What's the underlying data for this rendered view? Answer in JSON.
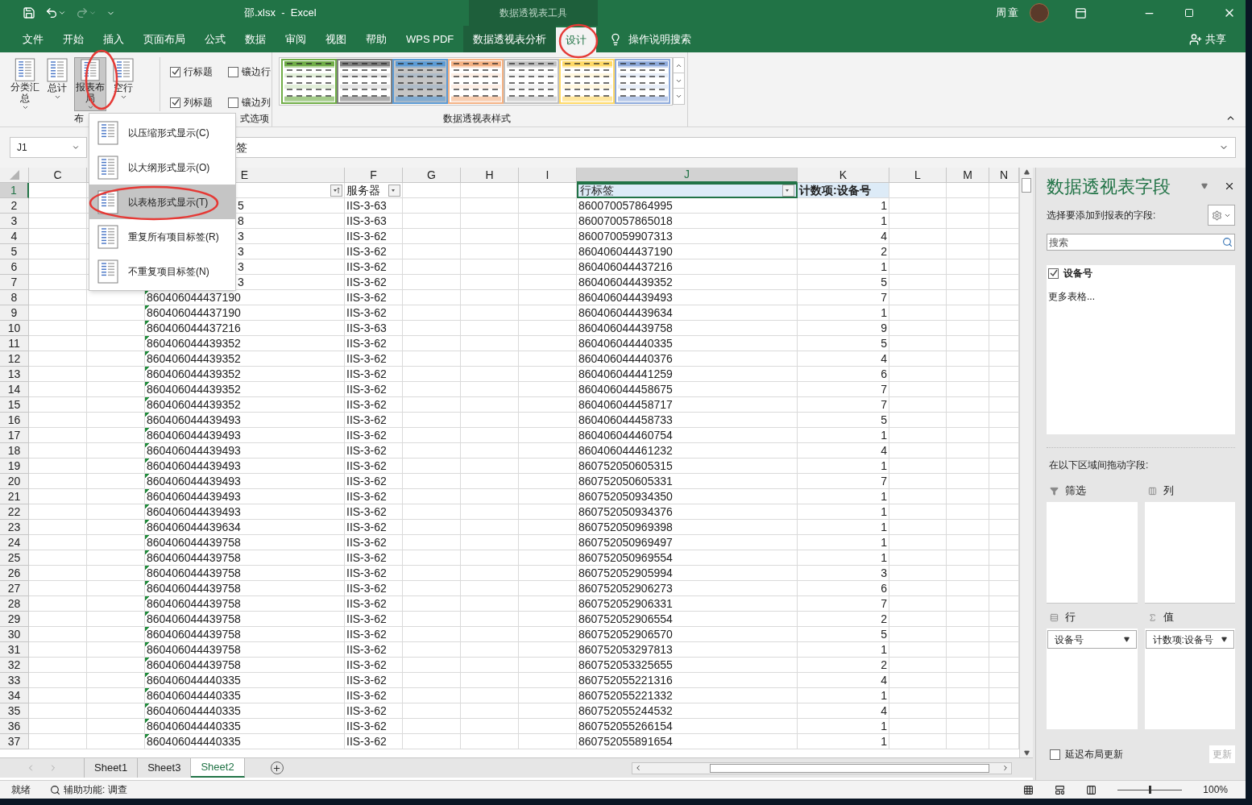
{
  "title_bar": {
    "title": "邵.xlsx  -  Excel",
    "context_label": "数据透视表工具",
    "user": "周童"
  },
  "ribbon_tabs": [
    {
      "label": "文件",
      "selected": false,
      "contextual": false
    },
    {
      "label": "开始",
      "selected": false,
      "contextual": false
    },
    {
      "label": "插入",
      "selected": false,
      "contextual": false
    },
    {
      "label": "页面布局",
      "selected": false,
      "contextual": false
    },
    {
      "label": "公式",
      "selected": false,
      "contextual": false
    },
    {
      "label": "数据",
      "selected": false,
      "contextual": false
    },
    {
      "label": "审阅",
      "selected": false,
      "contextual": false
    },
    {
      "label": "视图",
      "selected": false,
      "contextual": false
    },
    {
      "label": "帮助",
      "selected": false,
      "contextual": false
    },
    {
      "label": "WPS PDF",
      "selected": false,
      "contextual": false
    },
    {
      "label": "数据透视表分析",
      "selected": false,
      "contextual": true
    },
    {
      "label": "设计",
      "selected": true,
      "contextual": true
    }
  ],
  "tell_me": "操作说明搜索",
  "share": "共享",
  "ribbon": {
    "layout_group": {
      "label": "布",
      "buttons": [
        {
          "label": "分类汇总",
          "pressed": false
        },
        {
          "label": "总计",
          "pressed": false
        },
        {
          "label": "报表布局",
          "pressed": true
        },
        {
          "label": "空行",
          "pressed": false
        }
      ]
    },
    "options_group": {
      "label": "式选项",
      "options": [
        {
          "label": "行标题",
          "checked": true
        },
        {
          "label": "镶边行",
          "checked": false
        },
        {
          "label": "列标题",
          "checked": true
        },
        {
          "label": "镶边列",
          "checked": false
        }
      ]
    },
    "styles_group": {
      "label": "数据透视表样式",
      "styles": [
        {
          "color": "#70ad47",
          "selected": false
        },
        {
          "color": "#7f7f7f",
          "selected": false
        },
        {
          "color": "#5b9bd5",
          "selected": true
        },
        {
          "color": "#f4b183",
          "selected": false
        },
        {
          "color": "#bfbfbf",
          "selected": false
        },
        {
          "color": "#ffd966",
          "selected": false
        },
        {
          "color": "#8eaadb",
          "selected": false
        }
      ]
    }
  },
  "report_layout_menu": [
    {
      "label": "以压缩形式显示(C)",
      "selected": false
    },
    {
      "label": "以大纲形式显示(O)",
      "selected": false
    },
    {
      "label": "以表格形式显示(T)",
      "selected": true
    },
    {
      "label": "重复所有项目标签(R)",
      "selected": false
    },
    {
      "label": "不重复项目标签(N)",
      "selected": false
    }
  ],
  "formula_bar": {
    "name_box": "J1",
    "content": "签"
  },
  "columns": [
    {
      "letter": "C",
      "selected": false
    },
    {
      "letter": "E",
      "selected": false
    },
    {
      "letter": "F",
      "selected": false
    },
    {
      "letter": "G",
      "selected": false
    },
    {
      "letter": "H",
      "selected": false
    },
    {
      "letter": "I",
      "selected": false
    },
    {
      "letter": "J",
      "selected": true
    },
    {
      "letter": "K",
      "selected": false
    },
    {
      "letter": "L",
      "selected": false
    },
    {
      "letter": "M",
      "selected": false
    },
    {
      "letter": "N",
      "selected": false
    }
  ],
  "header_row": {
    "number": "1",
    "selected": true,
    "f": "服务器",
    "j": "行标签",
    "k": "计数项:设备号"
  },
  "rows": [
    {
      "number": "2",
      "e": "5",
      "e_cut": true,
      "f": "IIS-3-63",
      "j": "860070057864995",
      "k": "1"
    },
    {
      "number": "3",
      "e": "8",
      "e_cut": true,
      "f": "IIS-3-63",
      "j": "860070057865018",
      "k": "1"
    },
    {
      "number": "4",
      "e": "3",
      "e_cut": true,
      "f": "IIS-3-62",
      "j": "860070059907313",
      "k": "4"
    },
    {
      "number": "5",
      "e": "3",
      "e_cut": true,
      "f": "IIS-3-62",
      "j": "860406044437190",
      "k": "2"
    },
    {
      "number": "6",
      "e": "3",
      "e_cut": true,
      "f": "IIS-3-62",
      "j": "860406044437216",
      "k": "1"
    },
    {
      "number": "7",
      "e": "3",
      "e_cut": true,
      "f": "IIS-3-62",
      "j": "860406044439352",
      "k": "5"
    },
    {
      "number": "8",
      "e": "860406044437190",
      "e_cut": false,
      "flag": true,
      "f": "IIS-3-62",
      "j": "860406044439493",
      "k": "7"
    },
    {
      "number": "9",
      "e": "860406044437190",
      "e_cut": false,
      "flag": true,
      "f": "IIS-3-62",
      "j": "860406044439634",
      "k": "1"
    },
    {
      "number": "10",
      "e": "860406044437216",
      "e_cut": false,
      "flag": true,
      "f": "IIS-3-63",
      "j": "860406044439758",
      "k": "9"
    },
    {
      "number": "11",
      "e": "860406044439352",
      "e_cut": false,
      "flag": true,
      "f": "IIS-3-62",
      "j": "860406044440335",
      "k": "5"
    },
    {
      "number": "12",
      "e": "860406044439352",
      "e_cut": false,
      "flag": true,
      "f": "IIS-3-62",
      "j": "860406044440376",
      "k": "4"
    },
    {
      "number": "13",
      "e": "860406044439352",
      "e_cut": false,
      "flag": true,
      "f": "IIS-3-62",
      "j": "860406044441259",
      "k": "6"
    },
    {
      "number": "14",
      "e": "860406044439352",
      "e_cut": false,
      "flag": true,
      "f": "IIS-3-62",
      "j": "860406044458675",
      "k": "7"
    },
    {
      "number": "15",
      "e": "860406044439352",
      "e_cut": false,
      "flag": true,
      "f": "IIS-3-62",
      "j": "860406044458717",
      "k": "7"
    },
    {
      "number": "16",
      "e": "860406044439493",
      "e_cut": false,
      "flag": true,
      "f": "IIS-3-62",
      "j": "860406044458733",
      "k": "5"
    },
    {
      "number": "17",
      "e": "860406044439493",
      "e_cut": false,
      "flag": true,
      "f": "IIS-3-62",
      "j": "860406044460754",
      "k": "1"
    },
    {
      "number": "18",
      "e": "860406044439493",
      "e_cut": false,
      "flag": true,
      "f": "IIS-3-62",
      "j": "860406044461232",
      "k": "4"
    },
    {
      "number": "19",
      "e": "860406044439493",
      "e_cut": false,
      "flag": true,
      "f": "IIS-3-62",
      "j": "860752050605315",
      "k": "1"
    },
    {
      "number": "20",
      "e": "860406044439493",
      "e_cut": false,
      "flag": true,
      "f": "IIS-3-62",
      "j": "860752050605331",
      "k": "7"
    },
    {
      "number": "21",
      "e": "860406044439493",
      "e_cut": false,
      "flag": true,
      "f": "IIS-3-62",
      "j": "860752050934350",
      "k": "1"
    },
    {
      "number": "22",
      "e": "860406044439493",
      "e_cut": false,
      "flag": true,
      "f": "IIS-3-62",
      "j": "860752050934376",
      "k": "1"
    },
    {
      "number": "23",
      "e": "860406044439634",
      "e_cut": false,
      "flag": true,
      "f": "IIS-3-62",
      "j": "860752050969398",
      "k": "1"
    },
    {
      "number": "24",
      "e": "860406044439758",
      "e_cut": false,
      "flag": true,
      "f": "IIS-3-62",
      "j": "860752050969497",
      "k": "1"
    },
    {
      "number": "25",
      "e": "860406044439758",
      "e_cut": false,
      "flag": true,
      "f": "IIS-3-62",
      "j": "860752050969554",
      "k": "1"
    },
    {
      "number": "26",
      "e": "860406044439758",
      "e_cut": false,
      "flag": true,
      "f": "IIS-3-62",
      "j": "860752052905994",
      "k": "3"
    },
    {
      "number": "27",
      "e": "860406044439758",
      "e_cut": false,
      "flag": true,
      "f": "IIS-3-62",
      "j": "860752052906273",
      "k": "6"
    },
    {
      "number": "28",
      "e": "860406044439758",
      "e_cut": false,
      "flag": true,
      "f": "IIS-3-62",
      "j": "860752052906331",
      "k": "7"
    },
    {
      "number": "29",
      "e": "860406044439758",
      "e_cut": false,
      "flag": true,
      "f": "IIS-3-62",
      "j": "860752052906554",
      "k": "2"
    },
    {
      "number": "30",
      "e": "860406044439758",
      "e_cut": false,
      "flag": true,
      "f": "IIS-3-62",
      "j": "860752052906570",
      "k": "5"
    },
    {
      "number": "31",
      "e": "860406044439758",
      "e_cut": false,
      "flag": true,
      "f": "IIS-3-62",
      "j": "860752053297813",
      "k": "1"
    },
    {
      "number": "32",
      "e": "860406044439758",
      "e_cut": false,
      "flag": true,
      "f": "IIS-3-62",
      "j": "860752053325655",
      "k": "2"
    },
    {
      "number": "33",
      "e": "860406044440335",
      "e_cut": false,
      "flag": true,
      "f": "IIS-3-62",
      "j": "860752055221316",
      "k": "4"
    },
    {
      "number": "34",
      "e": "860406044440335",
      "e_cut": false,
      "flag": true,
      "f": "IIS-3-62",
      "j": "860752055221332",
      "k": "1"
    },
    {
      "number": "35",
      "e": "860406044440335",
      "e_cut": false,
      "flag": true,
      "f": "IIS-3-62",
      "j": "860752055244532",
      "k": "4"
    },
    {
      "number": "36",
      "e": "860406044440335",
      "e_cut": false,
      "flag": true,
      "f": "IIS-3-62",
      "j": "860752055266154",
      "k": "1"
    },
    {
      "number": "37",
      "e": "860406044440335",
      "e_cut": false,
      "flag": true,
      "f": "IIS-3-62",
      "j": "860752055891654",
      "k": "1"
    }
  ],
  "sheet_tabs": [
    {
      "label": "Sheet1",
      "selected": false
    },
    {
      "label": "Sheet3",
      "selected": false
    },
    {
      "label": "Sheet2",
      "selected": true
    }
  ],
  "pivot_pane": {
    "title": "数据透视表字段",
    "subtitle": "选择要添加到报表的字段:",
    "search": {
      "placeholder": "搜索"
    },
    "fields": [
      {
        "label": "设备号",
        "checked": true
      }
    ],
    "more_tables": "更多表格...",
    "areas_hint": "在以下区域间拖动字段:",
    "areas": [
      {
        "kind": "filter",
        "label": "筛选"
      },
      {
        "kind": "columns",
        "label": "列"
      },
      {
        "kind": "rows",
        "label": "行",
        "items": [
          "设备号"
        ]
      },
      {
        "kind": "values",
        "label": "值",
        "items": [
          "计数项:设备号"
        ]
      }
    ],
    "defer": {
      "label": "延迟布局更新",
      "checked": false
    },
    "update_button": {
      "label": "更新",
      "disabled": true
    }
  },
  "status_bar": {
    "ready": "就绪",
    "accessibility": "辅助功能: 调查",
    "zoom": "100%",
    "zoom_slider": {
      "level": 0.5
    }
  }
}
